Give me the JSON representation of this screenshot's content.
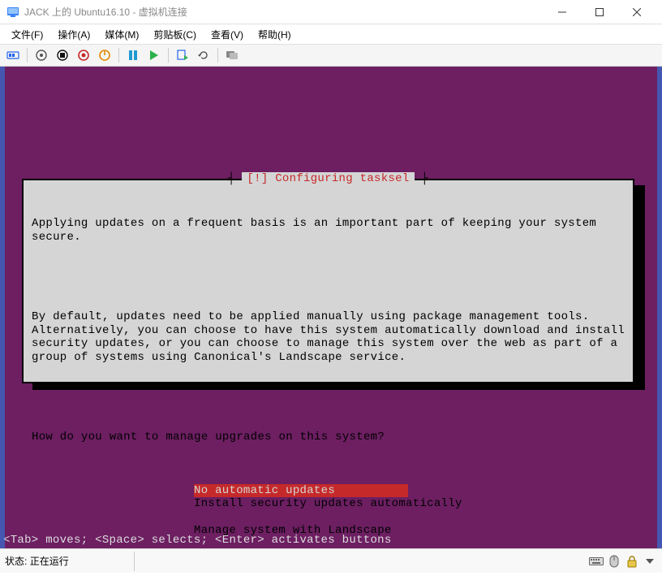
{
  "window": {
    "title": "JACK 上的 Ubuntu16.10 - 虚拟机连接"
  },
  "menu": {
    "file": "文件(F)",
    "action": "操作(A)",
    "media": "媒体(M)",
    "clipboard": "剪贴板(C)",
    "view": "查看(V)",
    "help": "帮助(H)"
  },
  "dialog": {
    "title": "[!] Configuring tasksel",
    "para1": "Applying updates on a frequent basis is an important part of keeping your system secure.",
    "para2": "By default, updates need to be applied manually using package management tools. Alternatively, you can choose to have this system automatically download and install security updates, or you can choose to manage this system over the web as part of a group of systems using Canonical's Landscape service.",
    "question": "How do you want to manage upgrades on this system?",
    "options": [
      "No automatic updates",
      "Install security updates automatically",
      "Manage system with Landscape"
    ]
  },
  "hint": "<Tab> moves; <Space> selects; <Enter> activates buttons",
  "status": {
    "label": "状态:",
    "value": "正在运行"
  }
}
